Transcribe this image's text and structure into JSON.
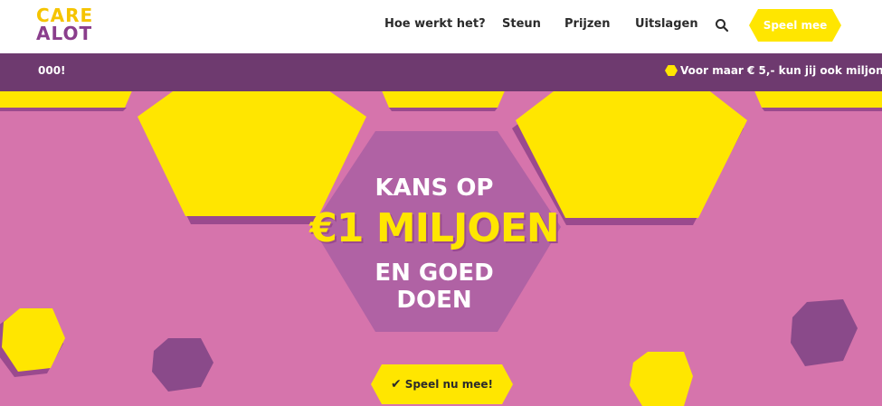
{
  "brand": {
    "logo_line1": "CARE",
    "logo_line2": "ALOT"
  },
  "nav": {
    "items": [
      {
        "label": "Hoe werkt het?"
      },
      {
        "label": "Steun"
      },
      {
        "label": "Prijzen"
      },
      {
        "label": "Uitslagen"
      }
    ],
    "cta_label": "Speel mee"
  },
  "ticker": {
    "left_text": "000!",
    "right_text": "Voor maar € 5,- kun jij ook miljon"
  },
  "hero": {
    "line1": "KANS OP",
    "line2": "€1 MILJOEN",
    "line3a": "EN GOED",
    "line3b": "DOEN",
    "cta_label": "Speel nu mee!"
  },
  "colors": {
    "brand_yellow": "#ffe600",
    "brand_purple": "#6e3a6f",
    "hero_pink": "#d674ac",
    "hex_dark_purple": "#8a4a8a"
  }
}
